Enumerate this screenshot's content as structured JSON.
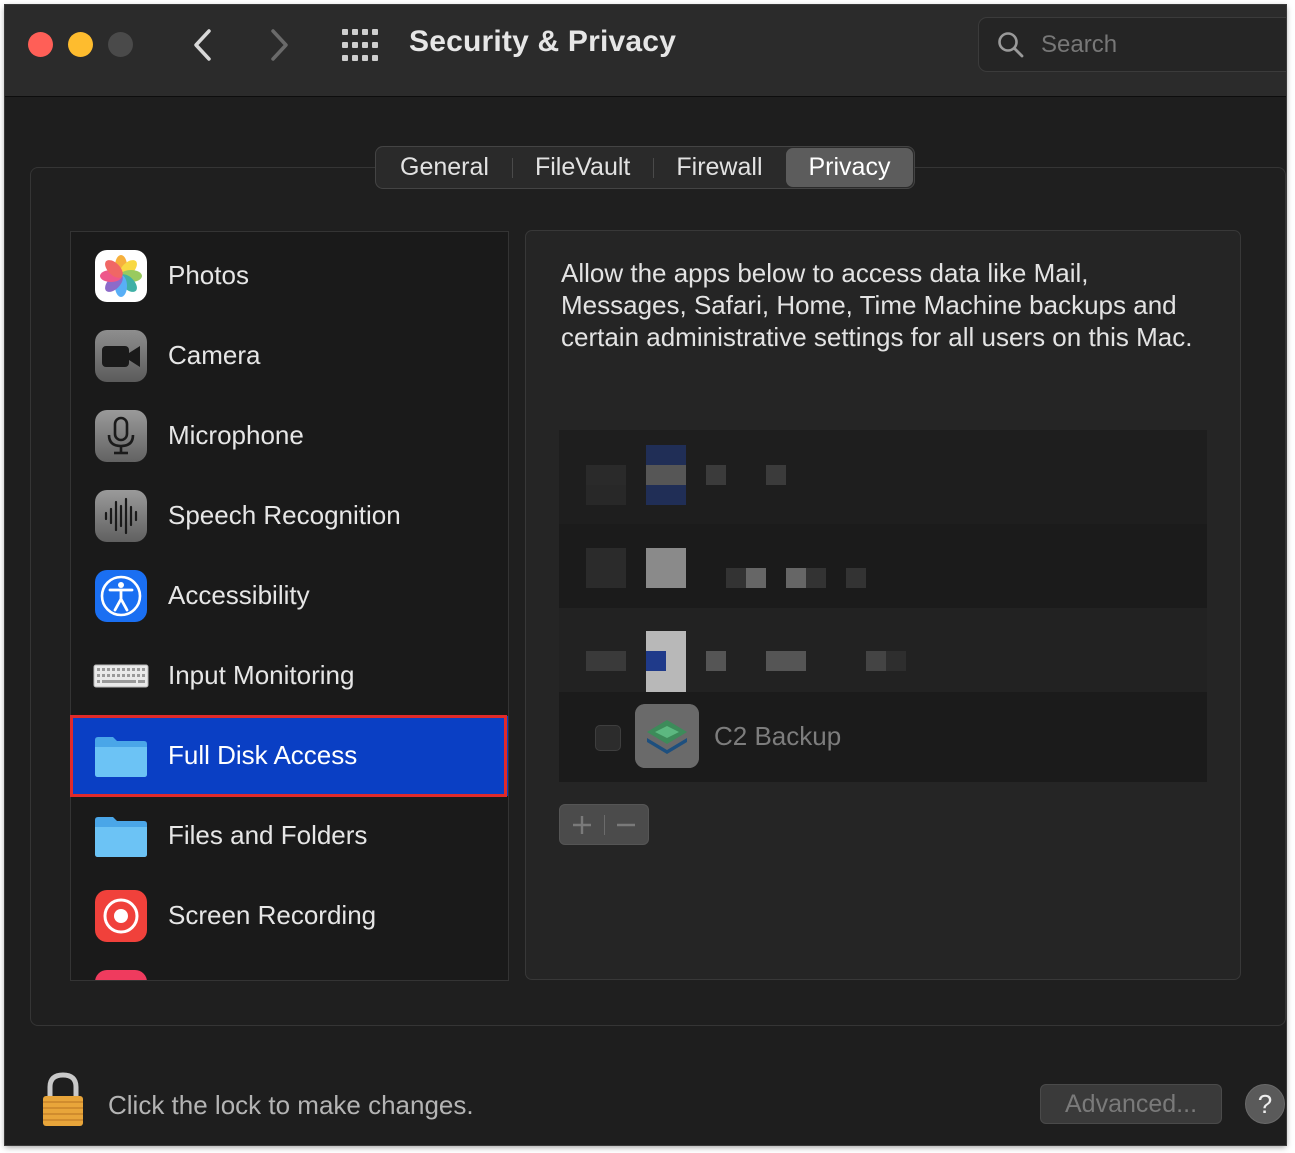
{
  "window": {
    "title": "Security & Privacy",
    "search_placeholder": "Search"
  },
  "tabs": [
    {
      "label": "General",
      "active": false
    },
    {
      "label": "FileVault",
      "active": false
    },
    {
      "label": "Firewall",
      "active": false
    },
    {
      "label": "Privacy",
      "active": true
    }
  ],
  "categories": [
    {
      "label": "Photos",
      "icon": "photos-icon"
    },
    {
      "label": "Camera",
      "icon": "camera-icon"
    },
    {
      "label": "Microphone",
      "icon": "microphone-icon"
    },
    {
      "label": "Speech Recognition",
      "icon": "waveform-icon"
    },
    {
      "label": "Accessibility",
      "icon": "accessibility-icon"
    },
    {
      "label": "Input Monitoring",
      "icon": "keyboard-icon"
    },
    {
      "label": "Full Disk Access",
      "icon": "folder-icon",
      "selected": true
    },
    {
      "label": "Files and Folders",
      "icon": "folder-icon"
    },
    {
      "label": "Screen Recording",
      "icon": "screen-recording-icon"
    }
  ],
  "detail": {
    "description": "Allow the apps below to access data like Mail, Messages, Safari, Home, Time Machine backups and certain administrative settings for all users on this Mac.",
    "apps": [
      {
        "name": "C2 Backup",
        "checked": false,
        "icon": "c2-backup-icon"
      }
    ],
    "add_symbol": "+",
    "remove_symbol": "−"
  },
  "footer": {
    "lock_text": "Click the lock to make changes.",
    "advanced_label": "Advanced...",
    "help_label": "?"
  },
  "colors": {
    "selection": "#0a3fc4",
    "highlight_border": "#e02a2a",
    "window_bg": "#1e1e1e"
  }
}
